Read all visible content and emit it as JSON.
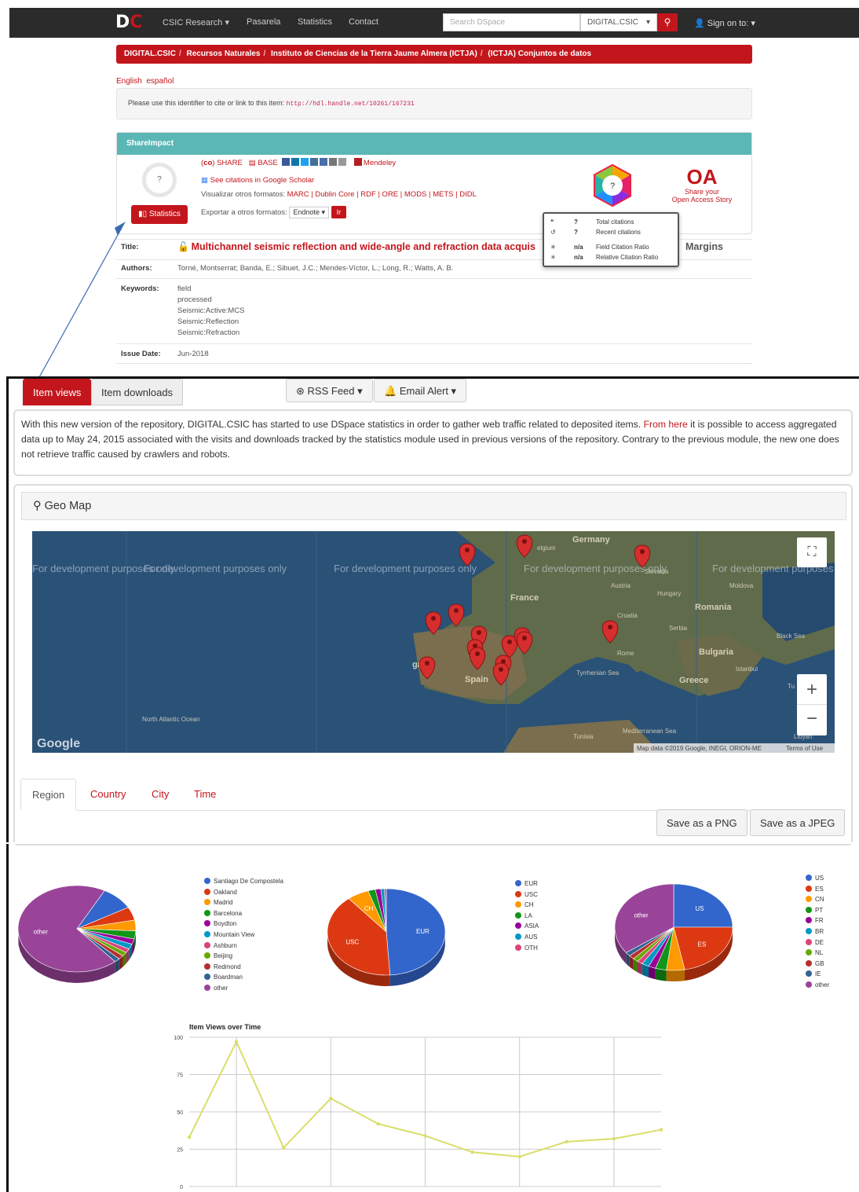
{
  "topnav": {
    "logo_d": "D",
    "logo_c": "C",
    "items": [
      "CSIC Research ▾",
      "Pasarela",
      "Statistics",
      "Contact"
    ],
    "search_placeholder": "Search DSpace",
    "scope": "DIGITAL.CSIC",
    "signin": "Sign on to: ▾"
  },
  "breadcrumb": [
    "DIGITAL.CSIC",
    "Recursos Naturales",
    "Instituto de Ciencias de la Tierra Jaume Almera (ICTJA)",
    "(ICTJA) Conjuntos de datos"
  ],
  "languages": [
    "English",
    "español"
  ],
  "handle": {
    "text": "Please use this identifier to cite or link to this item:",
    "url": "http://hdl.handle.net/10261/167231"
  },
  "shareimpact": {
    "header": "ShareImpact",
    "score": "?",
    "stats_button": "Statistics",
    "share_label": "SHARE",
    "base_label": "BASE",
    "mendeley_label": "Mendeley",
    "scholar_label": "See citations in Google Scholar",
    "formats_label": "Visualizar otros formatos:",
    "formats": "MARC | Dublin Core | RDF | ORE | MODS | METS | DIDL",
    "export_label": "Exportar a otros formatos:",
    "export_select": "Endnote",
    "export_button": "Ir",
    "dimensions_score": "?",
    "oa_logo": "OA",
    "oa_line1": "Share your",
    "oa_line2": "Open Access Story"
  },
  "citations_popup": [
    {
      "value": "?",
      "label": "Total citations"
    },
    {
      "value": "?",
      "label": "Recent citations"
    },
    {
      "value": "n/a",
      "label": "Field Citation Ratio"
    },
    {
      "value": "n/a",
      "label": "Relative Citation Ratio"
    }
  ],
  "metadata": {
    "title_label": "Title:",
    "title": "Multichannel seismic reflection and wide-angle and refraction data acquis",
    "title_tail": "Margins",
    "authors_label": "Authors:",
    "authors": "Torné, Montserrat; Banda, E.; Sibuet, J.C.; Mendes-Víctor, L.; Long, R.; Watts, A. B.",
    "keywords_label": "Keywords:",
    "keywords": [
      "field",
      "processed",
      "Seismic:Active:MCS",
      "Seismic:Reflection",
      "Seismic:Refraction"
    ],
    "issue_label": "Issue Date:",
    "issue_date": "Jun-2018"
  },
  "stats": {
    "tabs": [
      "Item views",
      "Item downloads"
    ],
    "rss": "RSS Feed ▾",
    "email": "Email Alert ▾",
    "notice_pre": "With this new version of the repository, DIGITAL.CSIC has started to use DSpace statistics in order to gather web traffic related to deposited items.",
    "notice_link": "From here",
    "notice_post": "it is possible to access aggregated data up to May 24, 2015 associated with the visits and downloads tracked by the statistics module used in previous versions of the repository. Contrary to the previous module, the new one does not retrieve traffic caused by crawlers and robots.",
    "geo_title": "Geo Map",
    "dev_text": "For development purposes only",
    "map_credit": "Map data ©2019 Google, INEGI, ORION-ME",
    "map_terms": "Terms of Use",
    "map_labels": [
      "Germany",
      "France",
      "Spain",
      "gal",
      "Austria",
      "Hungary",
      "Romania",
      "Croatia",
      "Serbia",
      "Bulgaria",
      "Greece",
      "Tunisia",
      "Rome",
      "North Atlantic Ocean",
      "Moldova",
      "Black Sea",
      "Istanbul",
      "Tyrrhenian Sea",
      "Mediterranean Sea",
      "elgium",
      "Slovakia",
      "Tu",
      "Libyan"
    ],
    "google_logo": "Google",
    "sub_tabs": [
      "Region",
      "Country",
      "City",
      "Time"
    ],
    "save_png": "Save as a PNG",
    "save_jpeg": "Save as a JPEG"
  },
  "chart_data": [
    {
      "type": "pie",
      "title": "",
      "labels": [
        "Santiago De Compostela",
        "Oakland",
        "Madrid",
        "Barcelona",
        "Boydton",
        "Mountain View",
        "Ashburn",
        "Beijing",
        "Redmond",
        "Boardman",
        "other"
      ],
      "values": [
        9,
        5,
        4,
        3,
        2,
        2,
        1.5,
        1.5,
        1.5,
        1.5,
        69
      ],
      "colors": [
        "#3366cc",
        "#dc3912",
        "#ff9900",
        "#109618",
        "#990099",
        "#0099c6",
        "#dd4477",
        "#66aa00",
        "#b82e2e",
        "#316395",
        "#994499"
      ],
      "slice_text": [
        "",
        "",
        "",
        "",
        "",
        "",
        "",
        "",
        "",
        "",
        "other"
      ]
    },
    {
      "type": "pie",
      "title": "",
      "labels": [
        "EUR",
        "USC",
        "CH",
        "LA",
        "ASIA",
        "AUS",
        "OTH"
      ],
      "values": [
        49,
        40,
        6,
        2,
        1.5,
        1,
        0.5
      ],
      "colors": [
        "#3366cc",
        "#dc3912",
        "#ff9900",
        "#109618",
        "#990099",
        "#0099c6",
        "#dd4477"
      ],
      "slice_text": [
        "EUR",
        "USC",
        "CH",
        "",
        "",
        "",
        ""
      ]
    },
    {
      "type": "pie",
      "title": "",
      "labels": [
        "US",
        "ES",
        "CN",
        "PT",
        "FR",
        "BR",
        "DE",
        "NL",
        "GB",
        "IE",
        "other"
      ],
      "values": [
        25,
        22,
        5,
        3,
        2,
        2,
        1.5,
        1.5,
        1.5,
        1.5,
        35
      ],
      "colors": [
        "#3366cc",
        "#dc3912",
        "#ff9900",
        "#109618",
        "#990099",
        "#0099c6",
        "#dd4477",
        "#66aa00",
        "#b82e2e",
        "#316395",
        "#994499"
      ],
      "slice_text": [
        "US",
        "ES",
        "",
        "",
        "",
        "",
        "",
        "",
        "",
        "",
        "other"
      ]
    },
    {
      "type": "line",
      "title": "Item Views over Time",
      "y_ticks": [
        0,
        25,
        50,
        75,
        100
      ],
      "ylim": [
        0,
        100
      ],
      "values": [
        33,
        97,
        26,
        59,
        42,
        34,
        23,
        20,
        30,
        32,
        38
      ],
      "color": "#d9de6a"
    }
  ],
  "colors": {
    "accent": "#c3161c",
    "teal": "#5bb7b5",
    "dark": "#2b2b2b"
  }
}
